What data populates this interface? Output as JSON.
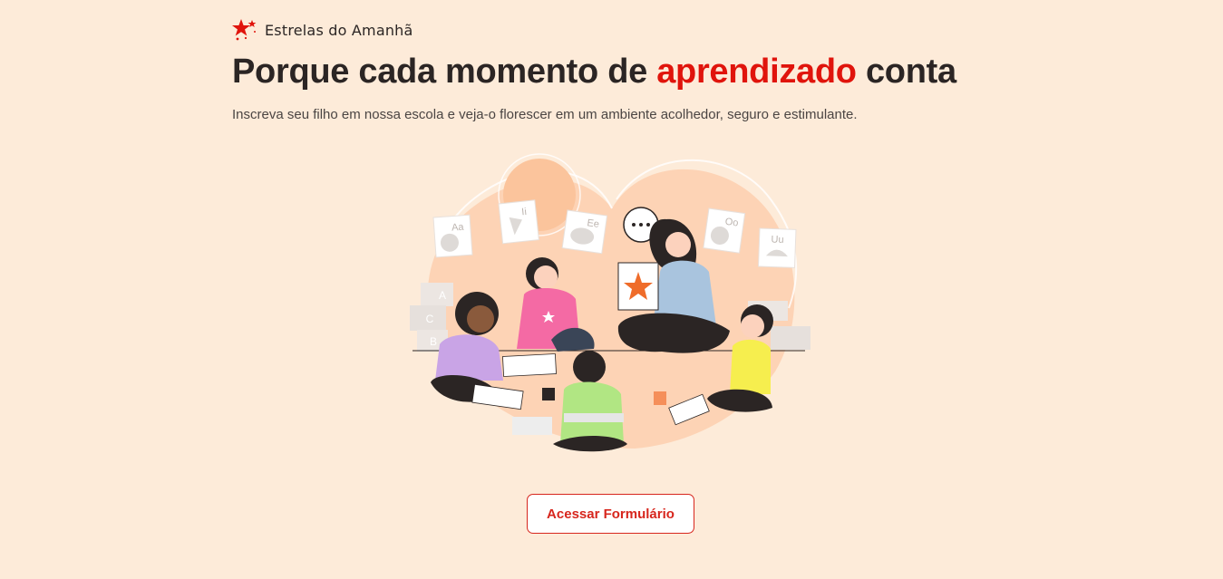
{
  "brand": {
    "name": "Estrelas do Amanhã",
    "logo_icon": "red-stars-logo",
    "color": "#e0140c"
  },
  "hero": {
    "title_part1": "Porque cada momento de ",
    "title_highlight": "aprendizado",
    "title_part2": " conta",
    "subtitle": "Inscreva seu filho em nossa escola e veja-o florescer em um ambiente acolhedor, seguro e estimulante.",
    "highlight_color": "#e0140c"
  },
  "illustration": {
    "subject": "teacher-with-children-illustration",
    "flashcards": [
      "Aa",
      "Ii",
      "Ee",
      "Oo",
      "Uu"
    ],
    "blocks": [
      "A",
      "C",
      "B"
    ]
  },
  "cta": {
    "label": "Acessar Formulário"
  },
  "colors": {
    "background": "#fdebd9",
    "accent": "#e0140c",
    "text": "#2b2524"
  }
}
